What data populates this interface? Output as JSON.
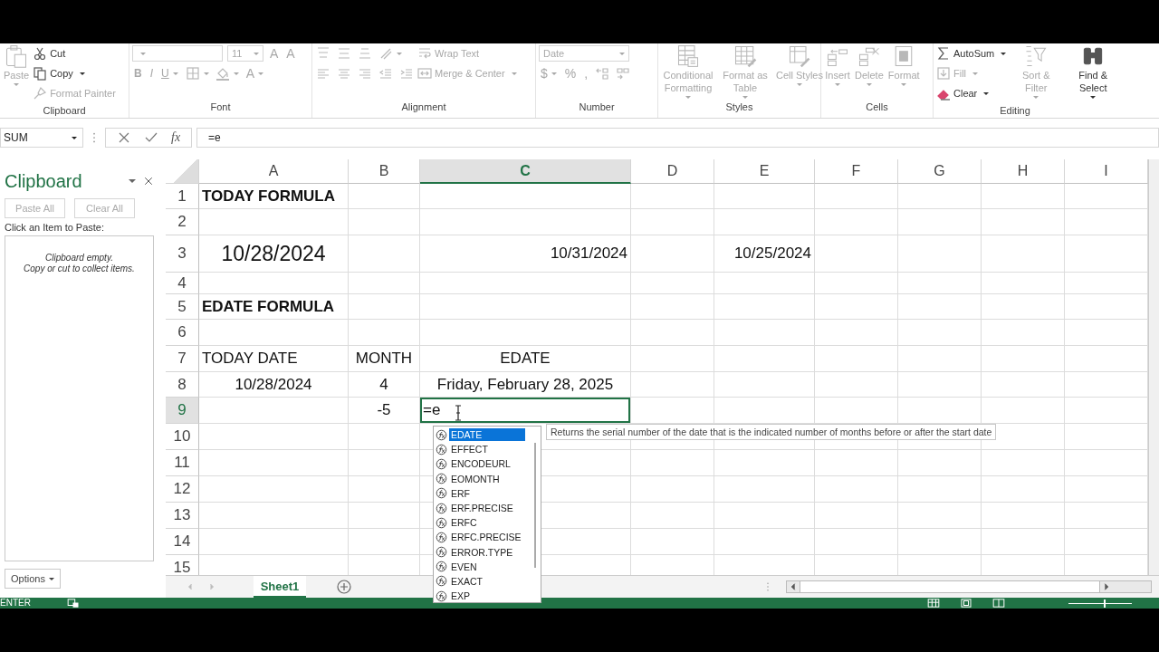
{
  "ribbon": {
    "groups": [
      {
        "label": "Clipboard",
        "columns": [
          {
            "kind": "large",
            "label": "Paste",
            "disabled": true,
            "caret": true
          },
          {
            "kind": "stack",
            "rows": [
              [
                {
                  "kind": "button",
                  "label": "Cut",
                  "disabled": false
                }
              ],
              [
                {
                  "kind": "button",
                  "label": "Copy",
                  "disabled": false,
                  "caret": true
                }
              ],
              [
                {
                  "kind": "button",
                  "label": "Format Painter",
                  "disabled": true
                }
              ]
            ]
          }
        ]
      },
      {
        "label": "Font",
        "columns": [
          {
            "kind": "stack",
            "rows": [
              [
                {
                  "kind": "combo",
                  "disabled": true
                },
                {
                  "kind": "combo",
                  "value": "11",
                  "disabled": true
                },
                {
                  "kind": "glyph",
                  "label": "A",
                  "disabled": true
                },
                {
                  "kind": "glyph",
                  "label": "A",
                  "disabled": true
                }
              ],
              [
                {
                  "kind": "bold",
                  "label": "B",
                  "disabled": true
                },
                {
                  "kind": "italic",
                  "label": "I",
                  "disabled": true
                },
                {
                  "kind": "underline",
                  "label": "U",
                  "disabled": true,
                  "caret": true
                },
                {
                  "kind": "icon",
                  "disabled": true,
                  "caret": true
                },
                {
                  "kind": "icon",
                  "disabled": true,
                  "caret": true
                },
                {
                  "kind": "glyph",
                  "label": "A",
                  "disabled": true,
                  "caret": true
                }
              ]
            ]
          }
        ]
      },
      {
        "label": "Alignment",
        "columns": [
          {
            "kind": "stack",
            "rows": [
              [
                {
                  "kind": "icon",
                  "disabled": true
                },
                {
                  "kind": "icon",
                  "disabled": true
                },
                {
                  "kind": "icon",
                  "disabled": true
                },
                {
                  "kind": "icon",
                  "disabled": true,
                  "caret": true
                }
              ],
              [
                {
                  "kind": "icon",
                  "disabled": true
                },
                {
                  "kind": "icon",
                  "disabled": true
                },
                {
                  "kind": "icon",
                  "disabled": true
                },
                {
                  "kind": "icon",
                  "disabled": true
                },
                {
                  "kind": "icon",
                  "disabled": true
                }
              ]
            ]
          },
          {
            "kind": "stack",
            "rows": [
              [
                {
                  "kind": "button",
                  "label": "Wrap Text",
                  "disabled": true
                }
              ],
              [
                {
                  "kind": "button",
                  "label": "Merge & Center",
                  "disabled": true,
                  "caret": true
                }
              ]
            ]
          }
        ]
      },
      {
        "label": "Number",
        "columns": [
          {
            "kind": "stack",
            "rows": [
              [
                {
                  "kind": "combo",
                  "value": "Date",
                  "disabled": true
                }
              ],
              [
                {
                  "kind": "glyph",
                  "label": "$",
                  "disabled": true,
                  "caret": true
                },
                {
                  "kind": "glyph",
                  "label": "%",
                  "disabled": true
                },
                {
                  "kind": "glyph",
                  "label": ",",
                  "disabled": true
                },
                {
                  "kind": "icon",
                  "disabled": true
                },
                {
                  "kind": "icon",
                  "disabled": true
                }
              ]
            ]
          }
        ]
      },
      {
        "label": "Styles",
        "columns": [
          {
            "kind": "large",
            "label": "Conditional Formatting",
            "disabled": true,
            "caret": true
          },
          {
            "kind": "large",
            "label": "Format as Table",
            "disabled": true,
            "caret": true
          },
          {
            "kind": "large",
            "label": "Cell Styles",
            "disabled": true,
            "caret": true
          }
        ]
      },
      {
        "label": "Cells",
        "columns": [
          {
            "kind": "large",
            "label": "Insert",
            "disabled": true,
            "caret": true
          },
          {
            "kind": "large",
            "label": "Delete",
            "disabled": true,
            "caret": true
          },
          {
            "kind": "large",
            "label": "Format",
            "disabled": true,
            "caret": true
          }
        ]
      },
      {
        "label": "Editing",
        "columns": [
          {
            "kind": "stack",
            "rows": [
              [
                {
                  "kind": "button",
                  "label": "AutoSum",
                  "disabled": false,
                  "caret": true
                }
              ],
              [
                {
                  "kind": "button",
                  "label": "Fill",
                  "disabled": true,
                  "caret": true
                }
              ],
              [
                {
                  "kind": "button",
                  "label": "Clear",
                  "disabled": false,
                  "caret": true
                }
              ]
            ]
          },
          {
            "kind": "large",
            "label": "Sort & Filter",
            "disabled": true,
            "caret": true
          },
          {
            "kind": "large",
            "label": "Find & Select",
            "disabled": false,
            "caret": true
          }
        ]
      }
    ]
  },
  "formula_bar": {
    "name_box": "SUM",
    "function_button": "fx",
    "formula": "=e"
  },
  "clipboard_pane": {
    "title": "Clipboard",
    "buttons": [
      {
        "label": "Paste All",
        "disabled": true
      },
      {
        "label": "Clear All",
        "disabled": true
      }
    ],
    "prompt": "Click an Item to Paste:",
    "empty_message": [
      "Clipboard empty.",
      "Copy or cut to collect items."
    ],
    "options": "Options"
  },
  "sheet": {
    "columns": [
      {
        "label": "A",
        "selected": false
      },
      {
        "label": "B",
        "selected": false
      },
      {
        "label": "C",
        "selected": true
      },
      {
        "label": "D",
        "selected": false
      },
      {
        "label": "E",
        "selected": false
      },
      {
        "label": "F",
        "selected": false
      },
      {
        "label": "G",
        "selected": false
      },
      {
        "label": "H",
        "selected": false
      },
      {
        "label": "I",
        "selected": false
      }
    ],
    "rows": [
      {
        "number": "1",
        "selected": false,
        "cells": [
          {
            "text": "TODAY FORMULA",
            "kind": "heading"
          }
        ]
      },
      {
        "number": "2",
        "selected": false
      },
      {
        "number": "3",
        "selected": false,
        "cells": [
          {
            "text": "10/28/2024",
            "kind": "large"
          },
          {},
          {
            "text": "10/31/2024",
            "kind": "right"
          },
          {},
          {
            "text": "10/25/2024",
            "kind": "right"
          }
        ]
      },
      {
        "number": "4",
        "selected": false
      },
      {
        "number": "5",
        "selected": false,
        "cells": [
          {
            "text": "EDATE FORMULA",
            "kind": "heading"
          }
        ]
      },
      {
        "number": "6",
        "selected": false
      },
      {
        "number": "7",
        "selected": false,
        "cells": [
          {
            "text": "TODAY DATE",
            "kind": "text"
          },
          {
            "text": "MONTH",
            "kind": "center"
          },
          {
            "text": "EDATE",
            "kind": "center"
          }
        ]
      },
      {
        "number": "8",
        "selected": false,
        "cells": [
          {
            "text": "10/28/2024",
            "kind": "center"
          },
          {
            "text": "4",
            "kind": "center"
          },
          {
            "text": "Friday, February 28, 2025",
            "kind": "center"
          }
        ]
      },
      {
        "number": "9",
        "selected": true,
        "cells": [
          {},
          {
            "text": "-5",
            "kind": "center"
          },
          {
            "text": "=e",
            "kind": "text",
            "editing": true
          }
        ]
      },
      {
        "number": "10",
        "selected": false
      },
      {
        "number": "11",
        "selected": false
      },
      {
        "number": "12",
        "selected": false
      },
      {
        "number": "13",
        "selected": false
      },
      {
        "number": "14",
        "selected": false
      },
      {
        "number": "15",
        "selected": false
      }
    ]
  },
  "autocomplete": {
    "items": [
      {
        "label": "EDATE",
        "selected": true
      },
      {
        "label": "EFFECT",
        "selected": false
      },
      {
        "label": "ENCODEURL",
        "selected": false
      },
      {
        "label": "EOMONTH",
        "selected": false
      },
      {
        "label": "ERF",
        "selected": false
      },
      {
        "label": "ERF.PRECISE",
        "selected": false
      },
      {
        "label": "ERFC",
        "selected": false
      },
      {
        "label": "ERFC.PRECISE",
        "selected": false
      },
      {
        "label": "ERROR.TYPE",
        "selected": false
      },
      {
        "label": "EVEN",
        "selected": false
      },
      {
        "label": "EXACT",
        "selected": false
      },
      {
        "label": "EXP",
        "selected": false
      }
    ],
    "tooltip": "Returns the serial number of the date that is the indicated number of months before or after the start date"
  },
  "sheet_tabs": [
    {
      "label": "Sheet1",
      "selected": true
    }
  ],
  "status_bar": {
    "mode": "ENTER",
    "zoom": {
      "level": 0.55
    }
  }
}
